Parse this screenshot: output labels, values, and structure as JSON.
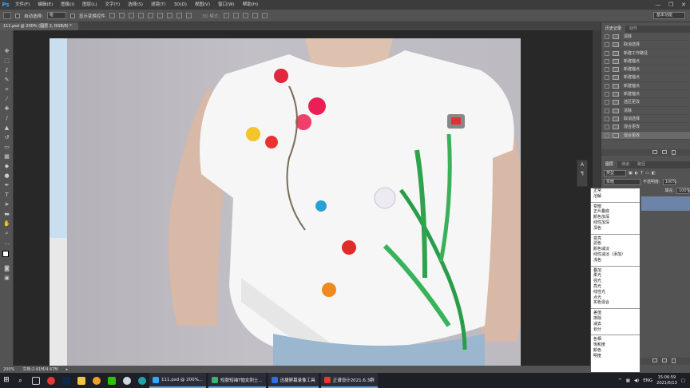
{
  "app": {
    "logo": "Ps"
  },
  "menu": [
    "文件(F)",
    "编辑(E)",
    "图像(I)",
    "图层(L)",
    "文字(Y)",
    "选择(S)",
    "滤镜(T)",
    "3D(D)",
    "视图(V)",
    "窗口(W)",
    "帮助(H)"
  ],
  "window_controls": [
    "—",
    "❐",
    "✕"
  ],
  "options_bar": {
    "auto_select_label": "自动选择:",
    "auto_select_value": "组",
    "show_transform_label": "显示变换控件",
    "mode_3d_label": "3D 模式:",
    "workspace": "基本功能"
  },
  "document": {
    "tab_title": "111.psd @ 200% (图层 2, RGB/8) *"
  },
  "status": {
    "zoom": "200%",
    "doc_info": "文档:2.41M/4.47M"
  },
  "history_panel": {
    "tabs": [
      "历史记录",
      "动作"
    ],
    "items": [
      {
        "label": "清除",
        "selected": false
      },
      {
        "label": "取消选择",
        "selected": false
      },
      {
        "label": "新建工作路径",
        "selected": false
      },
      {
        "label": "新建锚点",
        "selected": false
      },
      {
        "label": "新建锚点",
        "selected": false
      },
      {
        "label": "新建锚点",
        "selected": false
      },
      {
        "label": "新建锚点",
        "selected": false
      },
      {
        "label": "新建锚点",
        "selected": false
      },
      {
        "label": "选区更改",
        "selected": false
      },
      {
        "label": "清除",
        "selected": false
      },
      {
        "label": "取消选择",
        "selected": false
      },
      {
        "label": "混合更改",
        "selected": false
      },
      {
        "label": "混合更改",
        "selected": true
      }
    ]
  },
  "layers_panel": {
    "tabs": [
      "图层",
      "通道",
      "路径"
    ],
    "kind_filter": "类型",
    "blend_mode": "变暗",
    "opacity_label": "不透明度:",
    "opacity_value": "100%",
    "fill_label": "填充:",
    "fill_value": "100%"
  },
  "blend_modes": [
    [
      "正常",
      "溶解"
    ],
    [
      "变暗",
      "正片叠底",
      "颜色加深",
      "线性加深",
      "深色"
    ],
    [
      "变亮",
      "滤色",
      "颜色减淡",
      "线性减淡（添加）",
      "浅色"
    ],
    [
      "叠加",
      "柔光",
      "强光",
      "亮光",
      "线性光",
      "点光",
      "实色混合"
    ],
    [
      "差值",
      "排除",
      "减去",
      "划分"
    ],
    [
      "色相",
      "饱和度",
      "颜色",
      "明度"
    ]
  ],
  "taskbar": {
    "apps": [
      {
        "label": "111.psd @ 200%...",
        "color": "#31a8ff"
      },
      {
        "label": "短款短袖T恤女刺土...",
        "color": "#3cb371"
      },
      {
        "label": "迅捷屏幕录像工具",
        "color": "#2f6fd6"
      },
      {
        "label": "正谱设计2021.6.3群",
        "color": "#e53935"
      }
    ],
    "lang": "ENG",
    "time": "15:06:59",
    "date": "2021/6/13"
  }
}
